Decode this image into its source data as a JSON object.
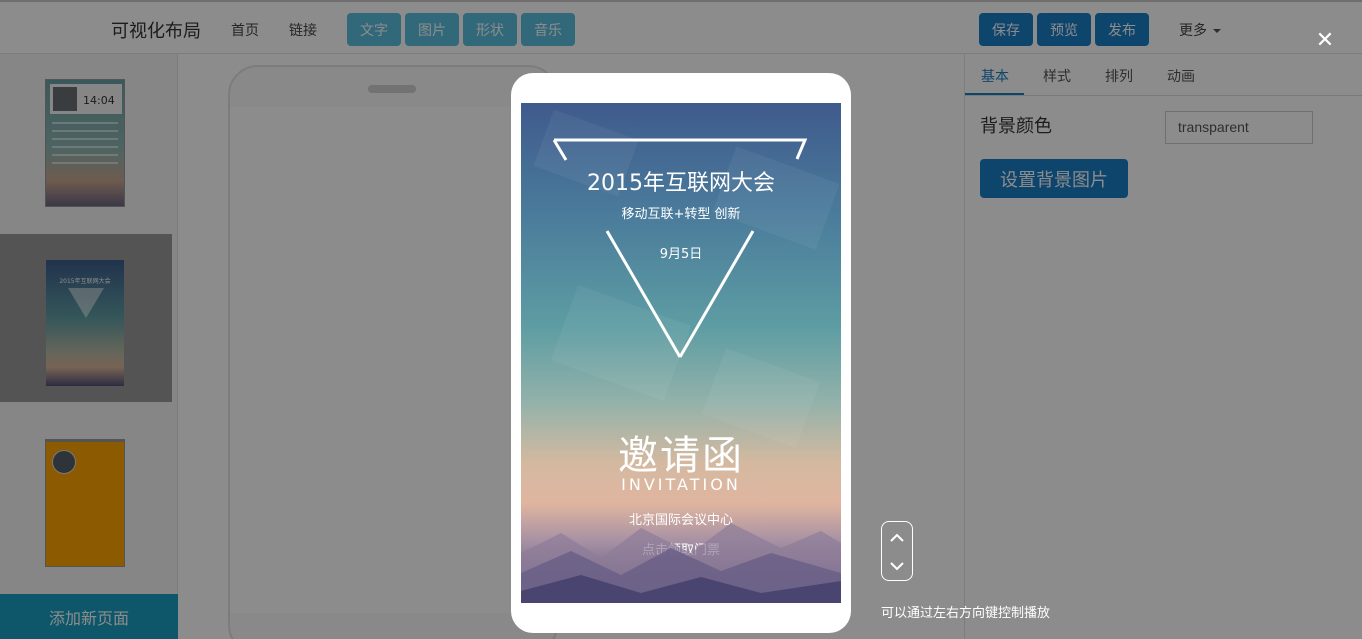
{
  "app": {
    "title": "可视化布局",
    "nav": [
      "首页",
      "链接"
    ],
    "tools": [
      "文字",
      "图片",
      "形状",
      "音乐"
    ],
    "actions": [
      "保存",
      "预览",
      "发布"
    ],
    "more": "更多"
  },
  "sidebar": {
    "thumb1_time": "14:04",
    "thumb2_title": "2015年互联网大会",
    "add_page": "添加新页面"
  },
  "properties": {
    "tabs": [
      "基本",
      "样式",
      "排列",
      "动画"
    ],
    "bg_color_label": "背景颜色",
    "bg_color_value": "transparent",
    "bg_image_button": "设置背景图片"
  },
  "preview": {
    "title": "2015年互联网大会",
    "subtitle": "移动互联+转型 创新",
    "date": "9月5日",
    "invite_cn": "邀请函",
    "invite_en": "INVITATION",
    "venue": "北京国际会议中心",
    "ticket": "点击领取门票",
    "hint": "可以通过左右方向键控制播放"
  },
  "colors": {
    "primary": "#1a7ec6",
    "tool": "#5bc0de",
    "add_page": "#1a9fc4",
    "thumb3_bg": "#ffa500"
  }
}
